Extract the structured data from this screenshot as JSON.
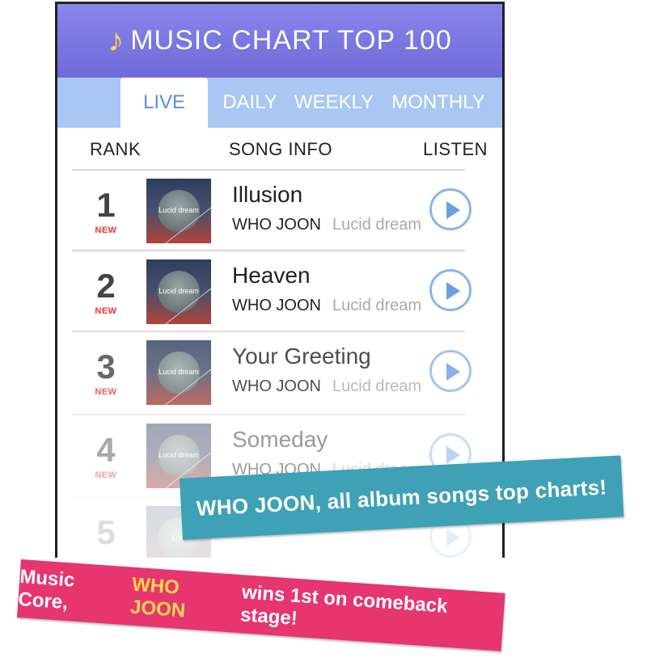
{
  "header": {
    "note_icon": "music-note-icon",
    "title": "MUSIC CHART TOP 100"
  },
  "tabs": [
    {
      "label": "LIVE",
      "active": true
    },
    {
      "label": "DAILY",
      "active": false
    },
    {
      "label": "WEEKLY",
      "active": false
    },
    {
      "label": "MONTHLY",
      "active": false
    }
  ],
  "columns": {
    "rank": "RANK",
    "song_info": "SONG INFO",
    "listen": "LISTEN"
  },
  "songs": [
    {
      "rank": "1",
      "badge": "NEW",
      "title": "Illusion",
      "artist": "WHO JOON",
      "album": "Lucid dream",
      "art_label": "Lucid dream"
    },
    {
      "rank": "2",
      "badge": "NEW",
      "title": "Heaven",
      "artist": "WHO JOON",
      "album": "Lucid dream",
      "art_label": "Lucid dream"
    },
    {
      "rank": "3",
      "badge": "NEW",
      "title": "Your Greeting",
      "artist": "WHO JOON",
      "album": "Lucid dream",
      "art_label": "Lucid dream"
    },
    {
      "rank": "4",
      "badge": "NEW",
      "title": "Someday",
      "artist": "WHO JOON",
      "album": "Lucid dream",
      "art_label": "Lucid dream"
    },
    {
      "rank": "5",
      "art_label": "Luci"
    }
  ],
  "banners": {
    "top": "WHO JOON, all album songs top charts!",
    "bottom_pre": "Music Core,",
    "bottom_highlight": "WHO JOON",
    "bottom_post": "wins 1st on comeback stage!"
  },
  "colors": {
    "header": "#7470e0",
    "tabs": "#a9c7f2",
    "accent": "#5b8fe0",
    "new_badge": "#e33333",
    "banner_teal": "#3fa1b5",
    "banner_pink": "#e6356f",
    "highlight": "#ffd84a"
  }
}
